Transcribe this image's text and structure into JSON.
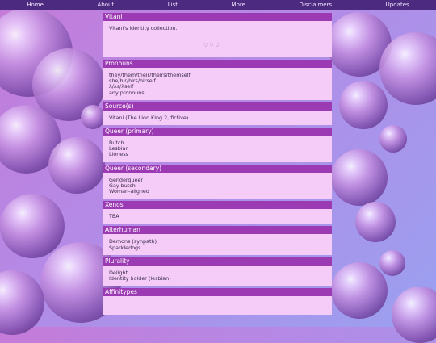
{
  "nav": {
    "items": [
      "Home",
      "About",
      "List",
      "More",
      "Disclaimers",
      "Updates"
    ]
  },
  "intro": {
    "title": "Vitani",
    "text": "Vitani's identity collection.",
    "hearts": "♡ ♡ ♡"
  },
  "sections": [
    {
      "title": "Pronouns",
      "lines": [
        "they/them/their/theirs/themself",
        "she/hir/hirs/hirself",
        "λ/λs/λself",
        "any pronouns"
      ]
    },
    {
      "title": "Source(s)",
      "lines": [
        "Vitani (The Lion King 2, fictive)"
      ]
    },
    {
      "title": "Queer (primary)",
      "lines": [
        "Butch",
        "Lesbian",
        "Lioness"
      ]
    },
    {
      "title": "Queer (secondary)",
      "lines": [
        "Genderqueer",
        "Gay butch",
        "Woman-aligned"
      ]
    },
    {
      "title": "Xenos",
      "lines": [
        "TBA"
      ]
    },
    {
      "title": "Alterhuman",
      "lines": [
        "Demons (synpath)",
        "Sparkledogs"
      ]
    },
    {
      "title": "Plurality",
      "lines": [
        "Delight",
        "Identity holder (lesbian)"
      ]
    },
    {
      "title": "Affinitypes",
      "lines": []
    }
  ],
  "colors": {
    "nav_bg": "#4b2a80",
    "section_title_bg": "#9b3ab3",
    "section_body_bg": "#f4ccf7"
  }
}
